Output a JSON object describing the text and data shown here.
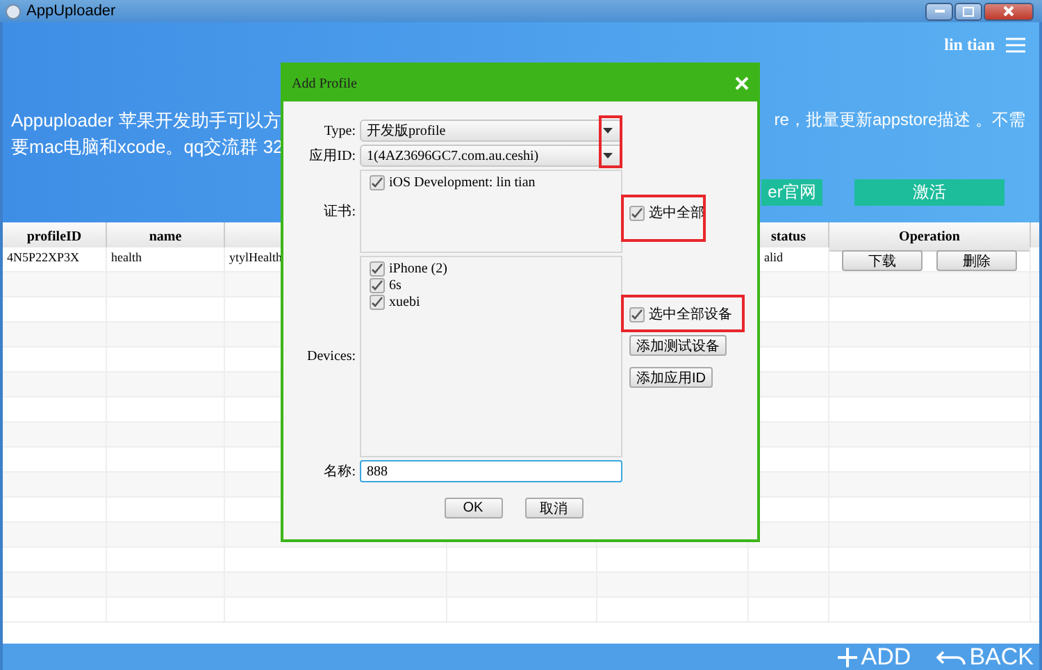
{
  "window": {
    "title": "AppUploader"
  },
  "header": {
    "user": "lin tian",
    "description_left": [
      "Appuploader 苹果开发助手可以方",
      "要mac电脑和xcode。qq交流群 32"
    ],
    "description_right": "re，批量更新appstore描述 。不需",
    "buttons": [
      "er官网",
      "激活"
    ]
  },
  "table": {
    "columns_left": [
      "profileID",
      "name"
    ],
    "columns_right": [
      "status",
      "Operation"
    ],
    "rows": [
      {
        "cells": [
          "4N5P22XP3X",
          "health",
          "ytylHealth"
        ],
        "status": "alid",
        "actions": [
          "下载",
          "删除"
        ]
      }
    ]
  },
  "dialog": {
    "title": "Add Profile",
    "type": {
      "label": "Type:",
      "value": "开发版profile"
    },
    "app_id": {
      "label": "应用ID:",
      "value": "1(4AZ3696GC7.com.au.ceshi)"
    },
    "certificates": {
      "label": "证书:",
      "items": [
        {
          "label": "iOS Development: lin tian",
          "checked": true
        }
      ],
      "select_all": {
        "label": "选中全部",
        "checked": true
      }
    },
    "devices": {
      "label": "Devices:",
      "items": [
        {
          "label": "iPhone (2)",
          "checked": true
        },
        {
          "label": "6s",
          "checked": true
        },
        {
          "label": "xuebi",
          "checked": true
        }
      ],
      "select_all": {
        "label": "选中全部设备",
        "checked": true
      }
    },
    "side_buttons": [
      "添加测试设备",
      "添加应用ID"
    ],
    "name": {
      "label": "名称:",
      "value": "888"
    },
    "buttons": [
      "OK",
      "取消"
    ]
  },
  "footer": {
    "add": "ADD",
    "back": "BACK"
  }
}
